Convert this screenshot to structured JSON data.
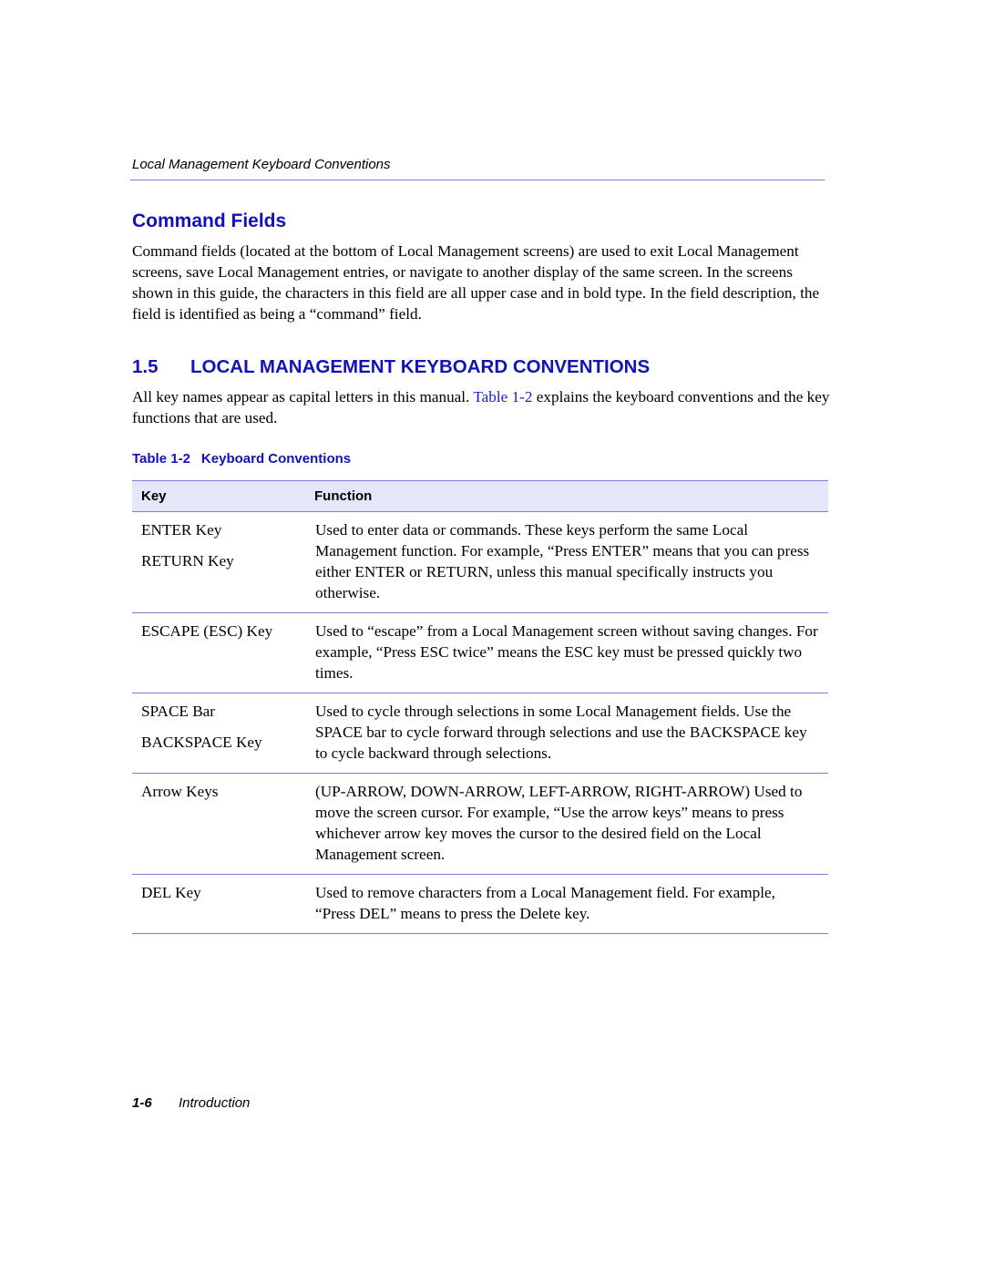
{
  "running_header": "Local Management Keyboard Conventions",
  "section_command_fields": {
    "title": "Command Fields",
    "paragraph": "Command fields (located at the bottom of Local Management screens) are used to exit Local Management screens, save Local Management entries, or navigate to another display of the same screen. In the screens shown in this guide, the characters in this field are all upper case and in bold type. In the field description, the field is identified as being a “command” field."
  },
  "section_keyboard": {
    "number": "1.5",
    "title": "LOCAL MANAGEMENT KEYBOARD CONVENTIONS",
    "paragraph_before": "All key names appear as capital letters in this manual. ",
    "paragraph_link": "Table 1-2",
    "paragraph_after": " explains the keyboard conventions and the key functions that are used."
  },
  "table": {
    "caption_label": "Table 1-2",
    "caption_title": "Keyboard Conventions",
    "headers": [
      "Key",
      "Function"
    ],
    "rows": [
      {
        "keys": [
          "ENTER Key",
          "RETURN Key"
        ],
        "function": "Used to enter data or commands. These keys perform the same Local Management function. For example, “Press ENTER” means that you can press either ENTER or RETURN, unless this manual specifically instructs you otherwise."
      },
      {
        "keys": [
          "ESCAPE (ESC) Key"
        ],
        "function": "Used to “escape” from a Local Management screen without saving changes. For example, “Press ESC twice” means the ESC key must be pressed quickly two times."
      },
      {
        "keys": [
          "SPACE Bar",
          "BACKSPACE Key"
        ],
        "function": "Used to cycle through selections in some Local Management fields. Use the SPACE bar to cycle forward through selections and use the BACKSPACE key to cycle backward through selections."
      },
      {
        "keys": [
          "Arrow Keys"
        ],
        "function": "(UP-ARROW, DOWN-ARROW, LEFT-ARROW, RIGHT-ARROW) Used to move the screen cursor. For example, “Use the arrow keys” means to press whichever arrow key moves the cursor to the desired field on the Local Management screen."
      },
      {
        "keys": [
          "DEL Key"
        ],
        "function": "Used to remove characters from a Local Management field. For example, “Press DEL” means to press the Delete key."
      }
    ]
  },
  "footer": {
    "page_number": "1-6",
    "chapter": "Introduction"
  },
  "colors": {
    "heading_blue": "#1212b8",
    "rule_blue": "#7d7fd6",
    "table_header_bg": "#e6e6fa",
    "link_blue": "#1a1ad0"
  }
}
